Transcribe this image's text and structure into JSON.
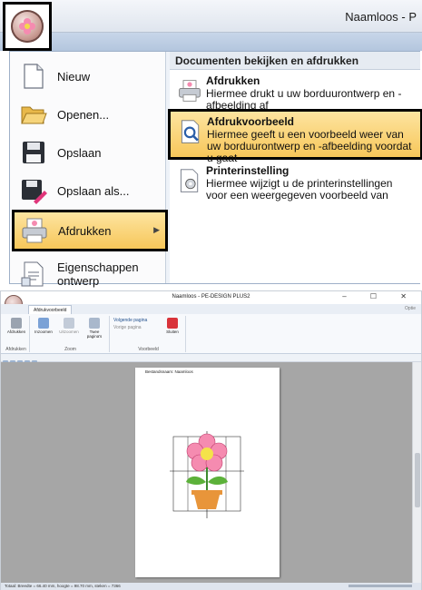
{
  "top": {
    "title": "Naamloos - P",
    "left_menu": [
      {
        "label": "Nieuw",
        "icon": "new-document-icon"
      },
      {
        "label": "Openen...",
        "icon": "open-folder-icon"
      },
      {
        "label": "Opslaan",
        "icon": "floppy-disk-icon"
      },
      {
        "label": "Opslaan als...",
        "icon": "save-as-icon"
      },
      {
        "label": "Afdrukken",
        "icon": "printer-icon"
      },
      {
        "label": "Eigenschappen ontwerp",
        "icon": "document-properties-icon"
      }
    ],
    "right_header": "Documenten bekijken en afdrukken",
    "right_items": [
      {
        "title": "Afdrukken",
        "desc": "Hiermee drukt u uw borduurontwerp en -afbeelding af",
        "icon": "printer-icon"
      },
      {
        "title": "Afdrukvoorbeeld",
        "desc": "Hiermee geeft u een voorbeeld weer van uw borduurontwerp en -afbeelding voordat u gaat",
        "icon": "print-preview-icon"
      },
      {
        "title": "Printerinstelling",
        "desc": "Hiermee wijzigt u de printerinstellingen voor een weergegeven voorbeeld van",
        "icon": "printer-settings-icon"
      }
    ]
  },
  "bottom": {
    "title": "Naamloos - PE-DESIGN PLUS2",
    "window_controls": "–  ☐  ✕",
    "tab": "Afdrukvoorbeeld",
    "options": "Optie",
    "groups": [
      "Afdrukken",
      "Zoom",
      "Voorbeeld"
    ],
    "buttons": {
      "print": "Afdrukken",
      "zoom_in": "Inzoomen",
      "zoom_out": "Uitzoomen",
      "two_pages": "Twee pagina's",
      "next_page": "Volgende pagina",
      "prev_page": "Vorige pagina",
      "close": "Sluiten"
    },
    "page_filename": "Bestandsnaam: Naamloos",
    "status": "Totaal: Breedte = 66.40 mm, hoogte = 98.70 mm, steken = 7366"
  }
}
